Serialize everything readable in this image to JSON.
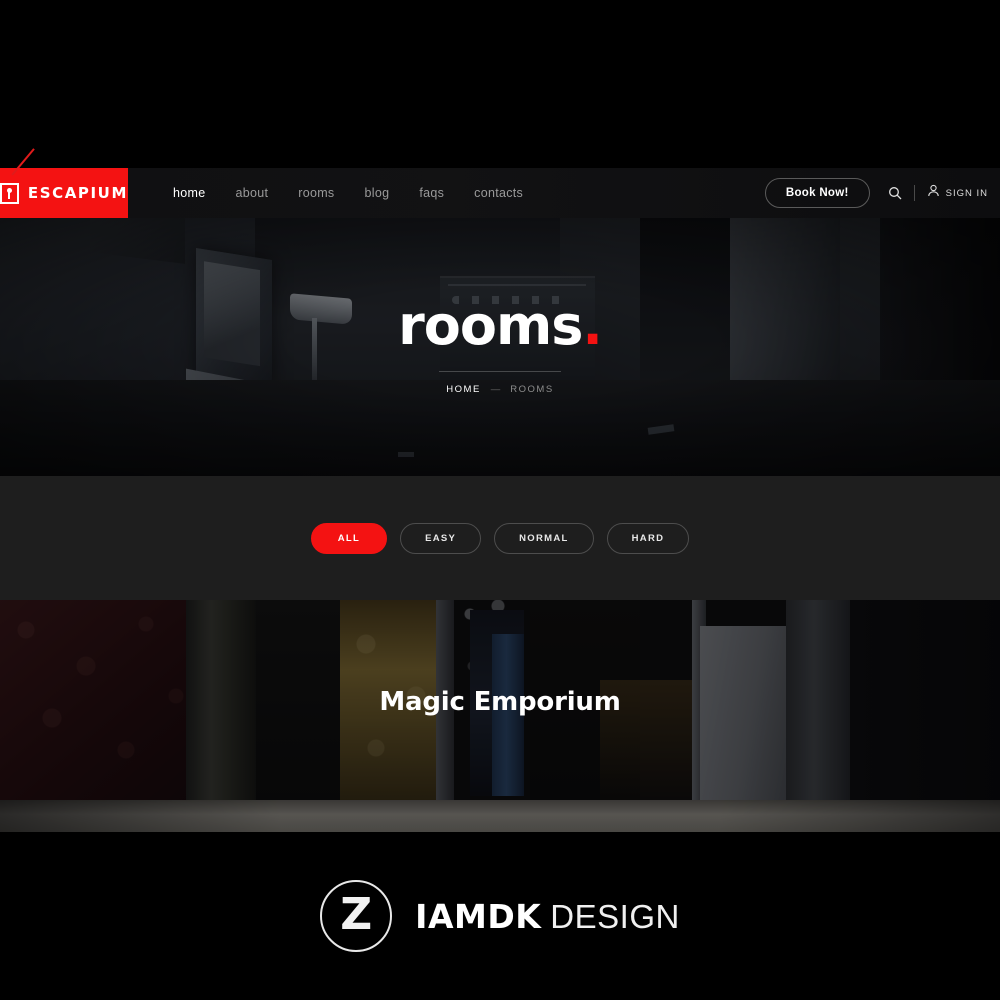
{
  "site": {
    "logo_text": "ESCAPIUM",
    "logo_icon": "keyhole-icon"
  },
  "nav": {
    "items": [
      {
        "label": "home",
        "active": true
      },
      {
        "label": "about",
        "active": false
      },
      {
        "label": "rooms",
        "active": false
      },
      {
        "label": "blog",
        "active": false
      },
      {
        "label": "faqs",
        "active": false
      },
      {
        "label": "contacts",
        "active": false
      }
    ],
    "book_label": "Book Now!",
    "search_icon": "search-icon",
    "user_icon": "user-icon",
    "signin_label": "SIGN IN"
  },
  "hero": {
    "title": "rooms",
    "title_dot": ".",
    "breadcrumb": {
      "home": "HOME",
      "separator": "—",
      "current": "ROOMS"
    }
  },
  "filters": {
    "items": [
      {
        "label": "ALL",
        "active": true
      },
      {
        "label": "EASY",
        "active": false
      },
      {
        "label": "NORMAL",
        "active": false
      },
      {
        "label": "HARD",
        "active": false
      }
    ]
  },
  "rooms": {
    "cards": [
      {
        "title": "Magic Emporium"
      }
    ]
  },
  "footer": {
    "logo_glyph": "Z",
    "brand_bold": "IAMDK",
    "brand_light": "DESIGN"
  },
  "colors": {
    "brand_red": "#f41212",
    "filter_bar_bg": "#1e1e1e",
    "page_bg": "#000000"
  }
}
